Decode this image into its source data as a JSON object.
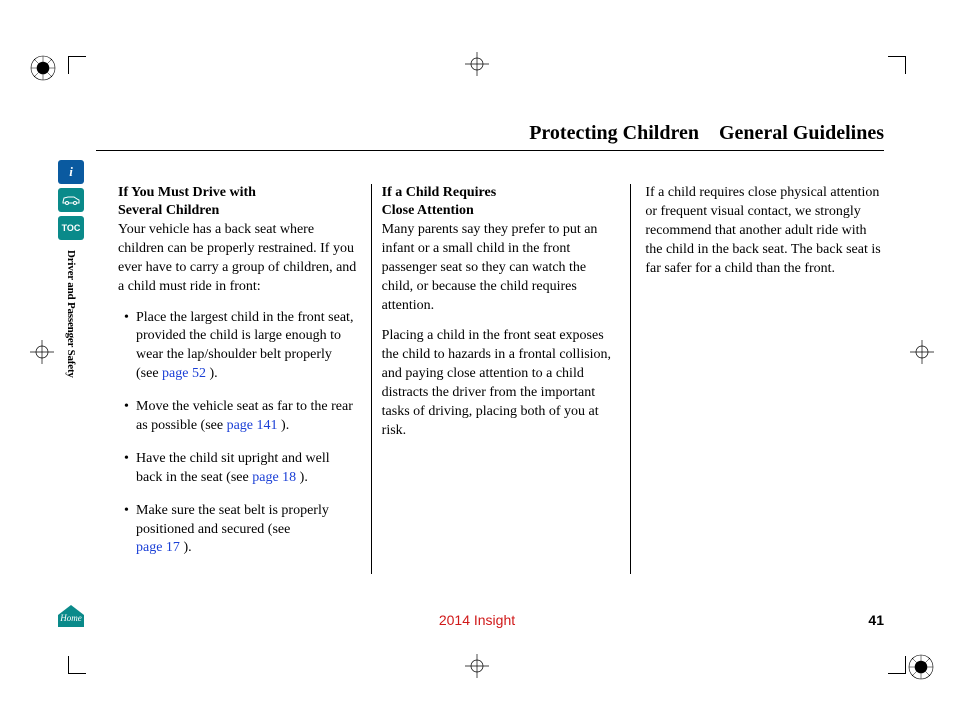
{
  "header": {
    "title_left": "Protecting Children",
    "title_right": "General Guidelines"
  },
  "nav": {
    "info_label": "i",
    "toc_label": "TOC",
    "section_label": "Driver and Passenger Safety",
    "home_label": "Home"
  },
  "col1": {
    "heading1": "If You Must Drive with",
    "heading2": "Several Children",
    "intro": "Your vehicle has a back seat where children can be properly restrained. If you ever have to carry a group of children, and a child must ride in front:",
    "b1a": "Place the largest child in the front seat, provided the child is large enough to wear the lap/shoulder belt properly (see ",
    "b1_link": "page 52",
    "b1b": " ).",
    "b2a": "Move the vehicle seat as far to the rear as possible (see ",
    "b2_link": "page 141",
    "b2b": " ).",
    "b3a": "Have the child sit upright and well back in the seat (see ",
    "b3_link": "page 18",
    "b3b": " ).",
    "b4a": "Make sure the seat belt is properly positioned and secured (see",
    "b4_link": "page 17",
    "b4b": " )."
  },
  "col2": {
    "heading1": "If a Child Requires",
    "heading2": "Close Attention",
    "p1": "Many parents say they prefer to put an infant or a small child in the front passenger seat so they can watch the child, or because the child requires attention.",
    "p2": "Placing a child in the front seat exposes the child to hazards in a frontal collision, and paying close attention to a child distracts the driver from the important tasks of driving, placing both of you at risk."
  },
  "col3": {
    "p1": "If a child requires close physical attention or frequent visual contact, we strongly recommend that another adult ride with the child in the back seat. The back seat is far safer for a child than the front."
  },
  "footer": {
    "model": "2014 Insight",
    "page": "41"
  }
}
